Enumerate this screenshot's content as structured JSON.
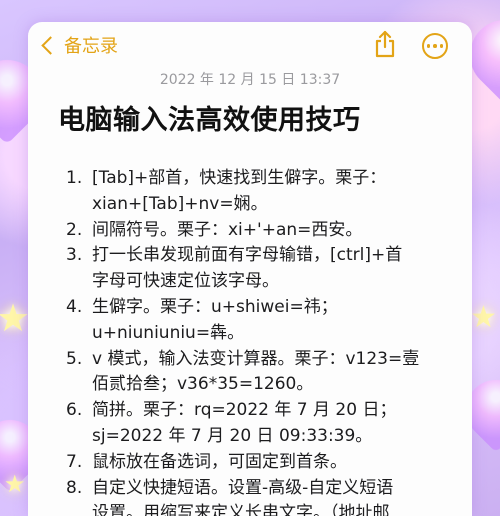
{
  "colors": {
    "accent": "#e3a417",
    "date_text": "#9a9a9e",
    "body_text": "#1c1c1e"
  },
  "nav": {
    "back_label": "备忘录",
    "back_icon": "chevron-left-icon",
    "share_icon": "share-icon",
    "more_icon": "more-icon"
  },
  "note": {
    "date": "2022 年 12 月 15 日 13:37",
    "title": "电脑输入法高效使用技巧",
    "items": [
      {
        "num": "1.",
        "lines": [
          "[Tab]+部首，快速找到生僻字。栗子：",
          "xian+[Tab]+nv=娴。"
        ]
      },
      {
        "num": "2.",
        "lines": [
          "间隔符号。栗子：xi+'+an=西安。"
        ]
      },
      {
        "num": "3.",
        "lines": [
          "打一长串发现前面有字母输错，[ctrl]+首",
          "字母可快速定位该字母。"
        ]
      },
      {
        "num": "4.",
        "lines": [
          "生僻字。栗子：u+shiwei=祎；",
          "u+niuniuniu=犇。"
        ]
      },
      {
        "num": "5.",
        "lines": [
          "v 模式，输入法变计算器。栗子：v123=壹",
          "佰贰拾叁；v36*35=1260。"
        ]
      },
      {
        "num": "6.",
        "lines": [
          "简拼。栗子：rq=2022 年 7 月 20 日；",
          "sj=2022 年 7 月 20 日 09:33:39。"
        ]
      },
      {
        "num": "7.",
        "lines": [
          "鼠标放在备选词，可固定到首条。"
        ]
      },
      {
        "num": "8.",
        "lines": [
          "自定义快捷短语。设置-高级-自定义短语",
          "设置。用缩写来定义长串文字。（地址邮"
        ]
      }
    ]
  }
}
